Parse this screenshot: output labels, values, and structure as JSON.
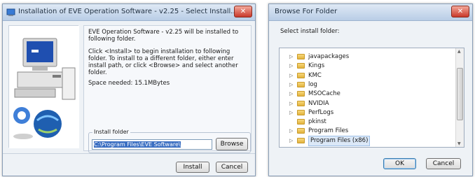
{
  "installer": {
    "title": "Installation of EVE Operation Software - v2.25 - Select Install...",
    "message_1": "EVE Operation Software - v2.25 will be installed to following folder.",
    "message_2": "Click <Install> to begin installation to following folder. To install to a different folder, either enter install path, or click <Browse> and select another folder.",
    "space_needed": "Space needed: 15.1MBytes",
    "group_label": "Install folder",
    "path_value": "C:\\Program Files\\EVE Software\\",
    "browse_label": "Browse",
    "install_label": "Install",
    "cancel_label": "Cancel"
  },
  "browse": {
    "title": "Browse For Folder",
    "prompt": "Select install folder:",
    "folders": [
      {
        "name": "javapackages",
        "expandable": true
      },
      {
        "name": "Kings",
        "expandable": true
      },
      {
        "name": "KMC",
        "expandable": true
      },
      {
        "name": "log",
        "expandable": true
      },
      {
        "name": "MSOCache",
        "expandable": true
      },
      {
        "name": "NVIDIA",
        "expandable": true
      },
      {
        "name": "PerfLogs",
        "expandable": true
      },
      {
        "name": "pkinst",
        "expandable": false
      },
      {
        "name": "Program Files",
        "expandable": true
      },
      {
        "name": "Program Files (x86)",
        "expandable": true
      }
    ],
    "ok_label": "OK",
    "cancel_label": "Cancel"
  },
  "window_controls": {
    "minimize": "–",
    "maximize": "□",
    "close": "✕"
  }
}
